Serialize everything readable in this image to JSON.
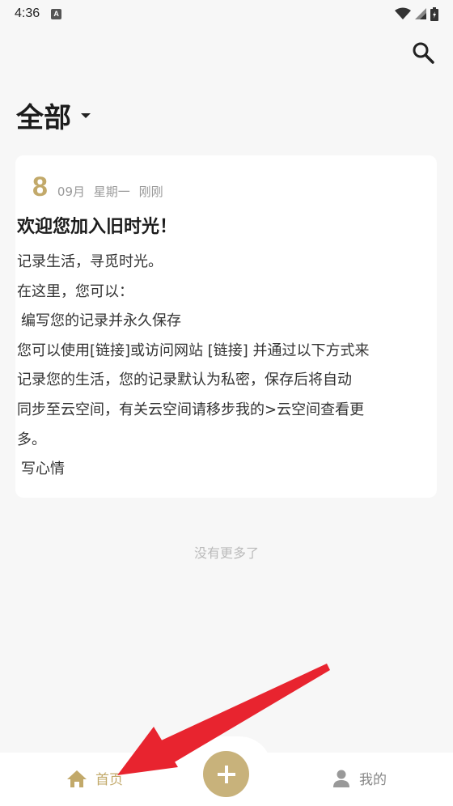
{
  "status_bar": {
    "time": "4:36",
    "icons": [
      "a-notification-icon",
      "wifi-icon",
      "signal-icon",
      "battery-icon"
    ]
  },
  "header": {
    "title": "全部",
    "search_icon": "search-icon"
  },
  "entry": {
    "day": "8",
    "month": "09月",
    "weekday": "星期一",
    "relative_time": "刚刚",
    "title": "欢迎您加入旧时光！",
    "body_lines": [
      "记录生活，寻觅时光。",
      "在这里，您可以：",
      " 编写您的记录并永久保存",
      "您可以使用[链接]或访问网站 [链接] 并通过以下方式来",
      "记录您的生活，您的记录默认为私密，保存后将自动",
      "同步至云空间，有关云空间请移步我的>云空间查看更",
      "多。",
      " 写心情"
    ]
  },
  "footer_note": "没有更多了",
  "bottom_nav": {
    "home_label": "首页",
    "add_label": "+",
    "mine_label": "我的"
  },
  "colors": {
    "accent": "#c2a96a",
    "add_button": "#c8b27b",
    "arrow": "#e8242f",
    "background": "#f7f7f7"
  }
}
